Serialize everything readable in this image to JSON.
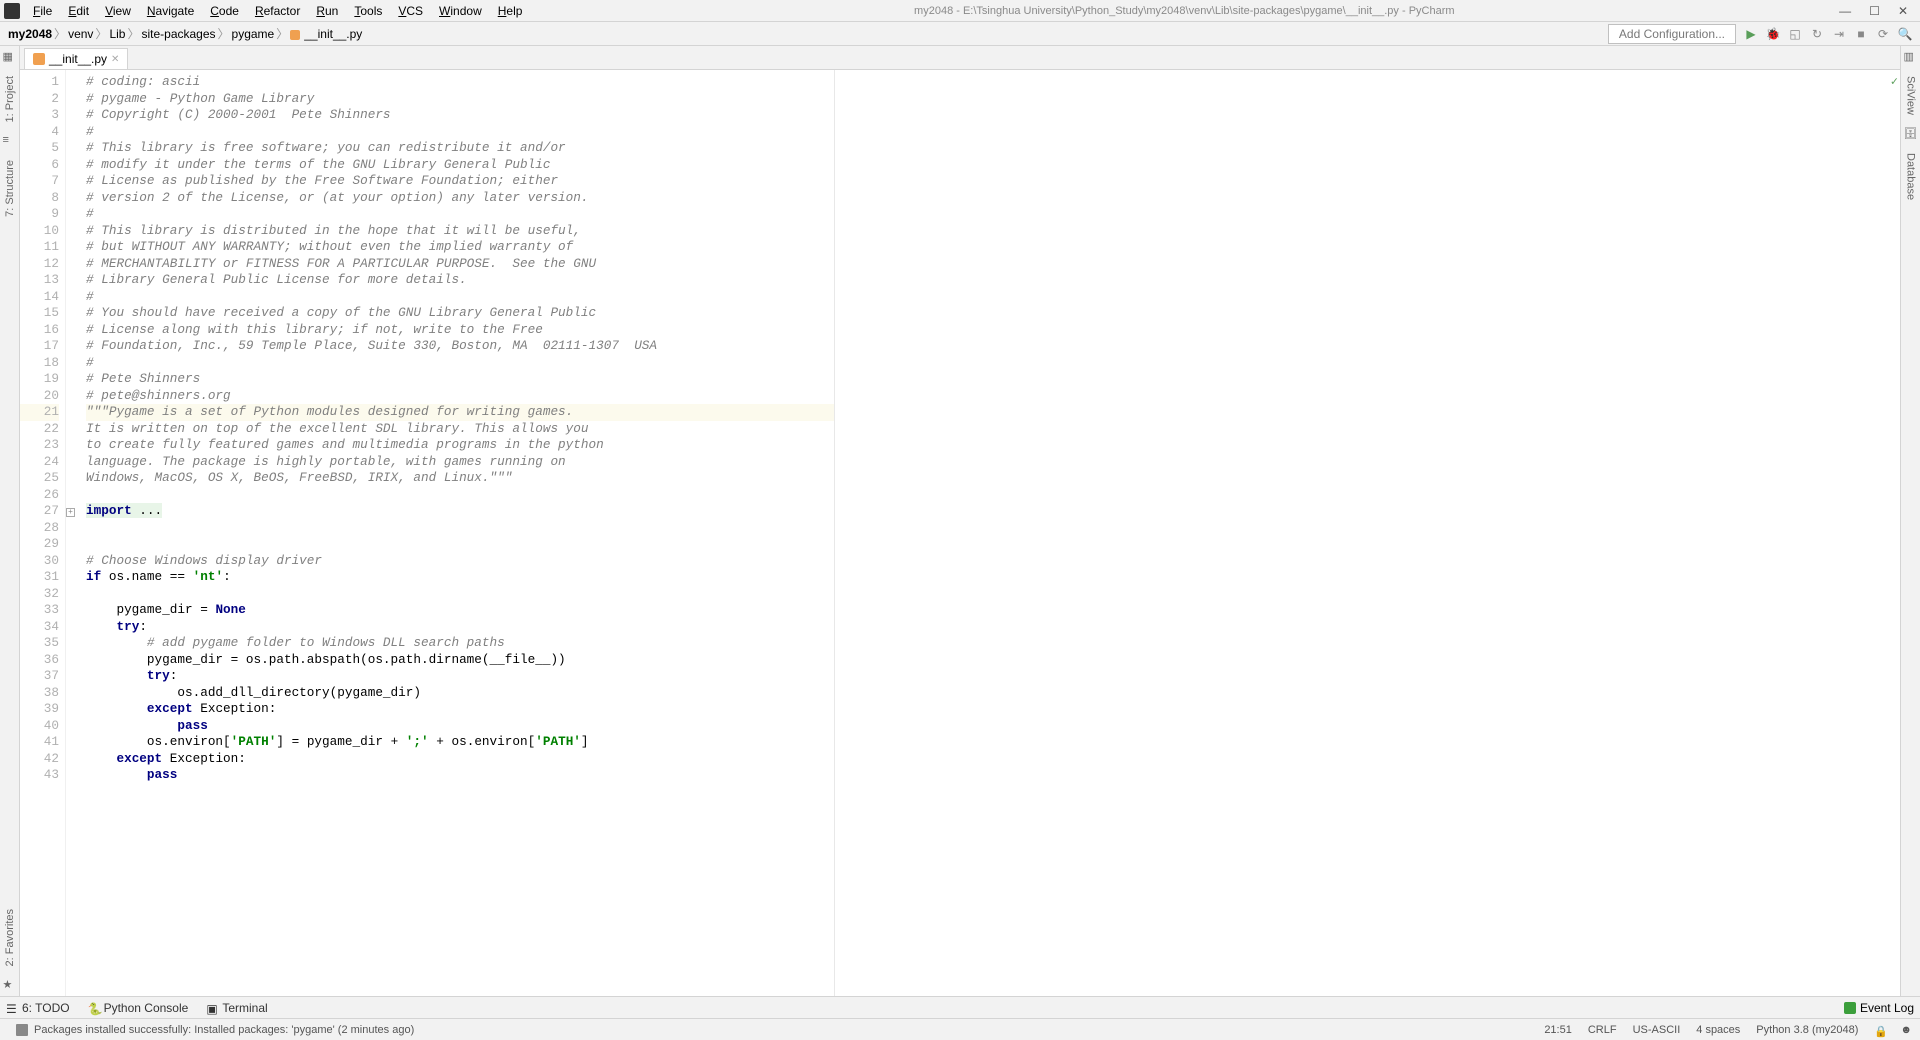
{
  "window": {
    "title_path": "my2048 - E:\\Tsinghua University\\Python_Study\\my2048\\venv\\Lib\\site-packages\\pygame\\__init__.py - PyCharm"
  },
  "menu": [
    "File",
    "Edit",
    "View",
    "Navigate",
    "Code",
    "Refactor",
    "Run",
    "Tools",
    "VCS",
    "Window",
    "Help"
  ],
  "breadcrumbs": [
    "my2048",
    "venv",
    "Lib",
    "site-packages",
    "pygame",
    "__init__.py"
  ],
  "config_button": "Add Configuration...",
  "tab": {
    "name": "__init__.py"
  },
  "left_tabs": [
    "1: Project",
    "7: Structure"
  ],
  "left_bottom": "2: Favorites",
  "right_tabs": [
    "SciView",
    "Database"
  ],
  "code": {
    "lines": [
      {
        "n": 1,
        "type": "comment",
        "text": "# coding: ascii"
      },
      {
        "n": 2,
        "type": "comment",
        "text": "# pygame - Python Game Library"
      },
      {
        "n": 3,
        "type": "comment",
        "text": "# Copyright (C) 2000-2001  Pete Shinners"
      },
      {
        "n": 4,
        "type": "comment",
        "text": "#"
      },
      {
        "n": 5,
        "type": "comment",
        "text": "# This library is free software; you can redistribute it and/or"
      },
      {
        "n": 6,
        "type": "comment",
        "text": "# modify it under the terms of the GNU Library General Public"
      },
      {
        "n": 7,
        "type": "comment",
        "text": "# License as published by the Free Software Foundation; either"
      },
      {
        "n": 8,
        "type": "comment",
        "text": "# version 2 of the License, or (at your option) any later version."
      },
      {
        "n": 9,
        "type": "comment",
        "text": "#"
      },
      {
        "n": 10,
        "type": "comment",
        "text": "# This library is distributed in the hope that it will be useful,"
      },
      {
        "n": 11,
        "type": "comment",
        "text": "# but WITHOUT ANY WARRANTY; without even the implied warranty of"
      },
      {
        "n": 12,
        "type": "comment",
        "text": "# MERCHANTABILITY or FITNESS FOR A PARTICULAR PURPOSE.  See the GNU"
      },
      {
        "n": 13,
        "type": "comment",
        "text": "# Library General Public License for more details."
      },
      {
        "n": 14,
        "type": "comment",
        "text": "#"
      },
      {
        "n": 15,
        "type": "comment",
        "text": "# You should have received a copy of the GNU Library General Public"
      },
      {
        "n": 16,
        "type": "comment",
        "text": "# License along with this library; if not, write to the Free"
      },
      {
        "n": 17,
        "type": "comment",
        "text": "# Foundation, Inc., 59 Temple Place, Suite 330, Boston, MA  02111-1307  USA"
      },
      {
        "n": 18,
        "type": "comment",
        "text": "#"
      },
      {
        "n": 19,
        "type": "comment",
        "text": "# Pete Shinners"
      },
      {
        "n": 20,
        "type": "comment",
        "text": "# pete@shinners.org"
      },
      {
        "n": 21,
        "type": "docstring",
        "hl": true,
        "text": "\"\"\"Pygame is a set of Python modules designed for writing games."
      },
      {
        "n": 22,
        "type": "docstring",
        "text": "It is written on top of the excellent SDL library. This allows you"
      },
      {
        "n": 23,
        "type": "docstring",
        "text": "to create fully featured games and multimedia programs in the python"
      },
      {
        "n": 24,
        "type": "docstring",
        "text": "language. The package is highly portable, with games running on"
      },
      {
        "n": 25,
        "type": "docstring",
        "text": "Windows, MacOS, OS X, BeOS, FreeBSD, IRIX, and Linux.\"\"\""
      },
      {
        "n": 26,
        "type": "blank",
        "text": ""
      },
      {
        "n": 27,
        "type": "import",
        "text": "import ..."
      },
      {
        "n": 28,
        "type": "blank",
        "text": ""
      },
      {
        "n": 29,
        "type": "blank",
        "text": ""
      },
      {
        "n": 30,
        "type": "comment",
        "text": "# Choose Windows display driver"
      },
      {
        "n": 31,
        "type": "code",
        "html": "<span class='c-kw'>if </span>os.name == <span class='c-str'>'nt'</span>:"
      },
      {
        "n": 32,
        "type": "blank",
        "text": ""
      },
      {
        "n": 33,
        "type": "code",
        "html": "    pygame_dir = <span class='c-kw'>None</span>"
      },
      {
        "n": 34,
        "type": "code",
        "html": "    <span class='c-kw'>try</span>:"
      },
      {
        "n": 35,
        "type": "comment",
        "text": "        # add pygame folder to Windows DLL search paths"
      },
      {
        "n": 36,
        "type": "code",
        "html": "        pygame_dir = os.path.abspath(os.path.dirname(__file__))"
      },
      {
        "n": 37,
        "type": "code",
        "html": "        <span class='c-kw'>try</span>:"
      },
      {
        "n": 38,
        "type": "code",
        "html": "            os.add_dll_directory(pygame_dir)"
      },
      {
        "n": 39,
        "type": "code",
        "html": "        <span class='c-kw'>except </span>Exception:"
      },
      {
        "n": 40,
        "type": "code",
        "html": "            <span class='c-kw'>pass</span>"
      },
      {
        "n": 41,
        "type": "code",
        "html": "        os.environ[<span class='c-str'>'PATH'</span>] = pygame_dir + <span class='c-str'>';'</span> + os.environ[<span class='c-str'>'PATH'</span>]"
      },
      {
        "n": 42,
        "type": "code",
        "html": "    <span class='c-kw'>except </span>Exception:"
      },
      {
        "n": 43,
        "type": "code",
        "html": "        <span class='c-kw'>pass</span>"
      }
    ]
  },
  "bottom_tabs": [
    {
      "icon": "list",
      "label": "6: TODO"
    },
    {
      "icon": "py",
      "label": "Python Console"
    },
    {
      "icon": "term",
      "label": "Terminal"
    }
  ],
  "event_log": "Event Log",
  "status_msg": "Packages installed successfully: Installed packages: 'pygame' (2 minutes ago)",
  "status_right": {
    "pos": "21:51",
    "eol": "CRLF",
    "enc": "US-ASCII",
    "indent": "4 spaces",
    "interp": "Python 3.8 (my2048)"
  }
}
